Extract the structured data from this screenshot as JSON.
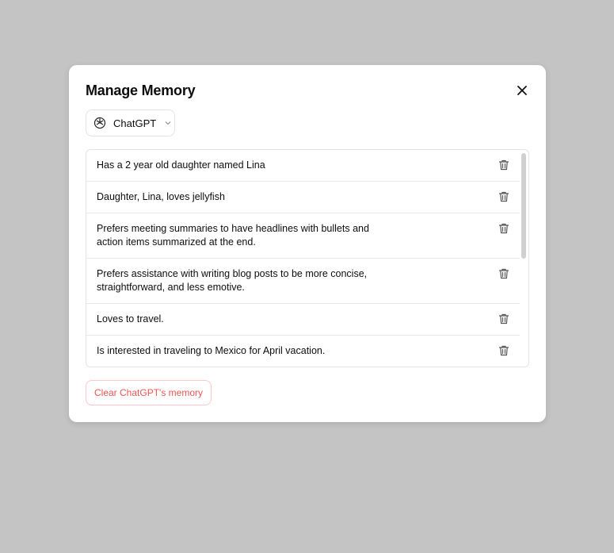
{
  "dialog": {
    "title": "Manage Memory",
    "close_icon": "close-icon"
  },
  "model_select": {
    "value": "ChatGPT",
    "icon": "openai-logo-icon"
  },
  "memories": [
    "Has a 2 year old daughter named Lina",
    "Daughter, Lina, loves jellyfish",
    "Prefers meeting summaries to have headlines with bullets and action items summarized at the end.",
    "Prefers assistance with writing blog posts to be more concise, straightforward, and less emotive.",
    "Loves to travel.",
    "Is interested in traveling to Mexico for April vacation.",
    ""
  ],
  "clear_button": {
    "label": "Clear ChatGPT's memory",
    "color": "#ef5454"
  }
}
